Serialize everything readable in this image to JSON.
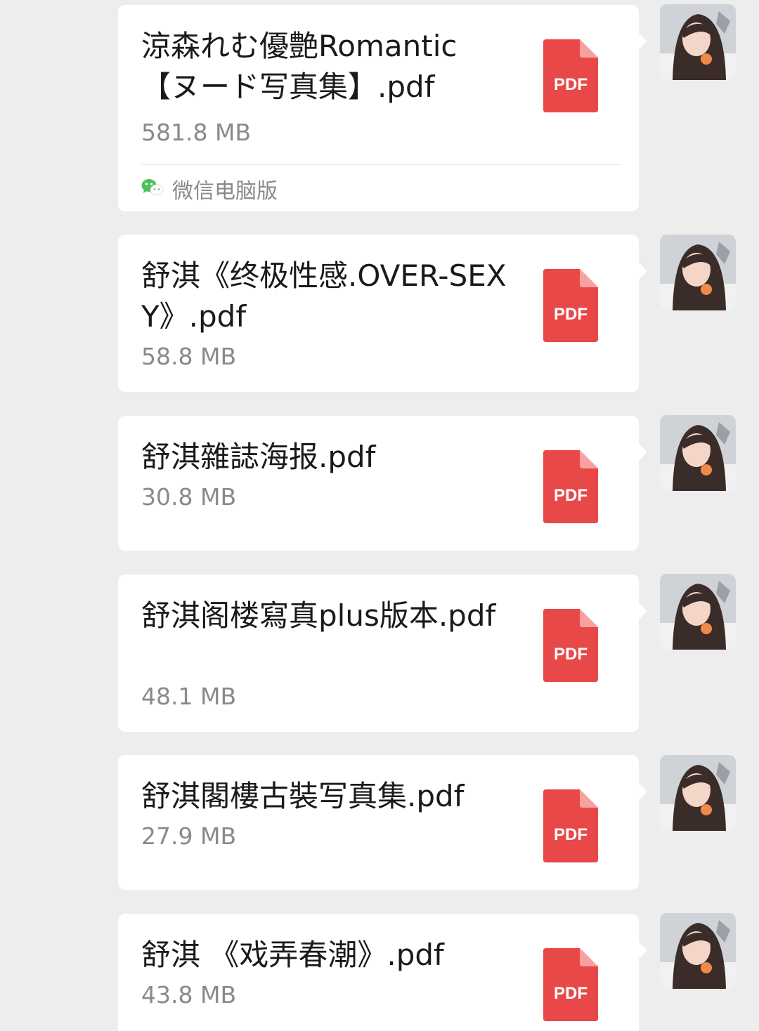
{
  "messages": [
    {
      "name": "涼森れむ優艶Romantic【ヌード写真集】.pdf",
      "size": "581.8 MB",
      "source": "微信电脑版"
    },
    {
      "name": "舒淇《终极性感.OVER-SEXY》.pdf",
      "size": "58.8 MB"
    },
    {
      "name": "舒淇雜誌海报.pdf",
      "size": "30.8 MB"
    },
    {
      "name": "舒淇阁楼寫真plus版本.pdf",
      "size": "48.1 MB"
    },
    {
      "name": "舒淇閣樓古裝写真集.pdf",
      "size": "27.9 MB"
    },
    {
      "name": "舒淇 《戏弄春潮》.pdf",
      "size": "43.8 MB"
    }
  ],
  "icons": {
    "file_type_icon": "pdf-file-icon",
    "file_type_label": "PDF",
    "source_icon": "wechat-icon",
    "avatar": "user-avatar"
  },
  "colors": {
    "background": "#ededed",
    "bubble": "#ffffff",
    "pdf_red": "#e94848",
    "wechat_green": "#4cc15a",
    "secondary_text": "#8a8a8a"
  }
}
